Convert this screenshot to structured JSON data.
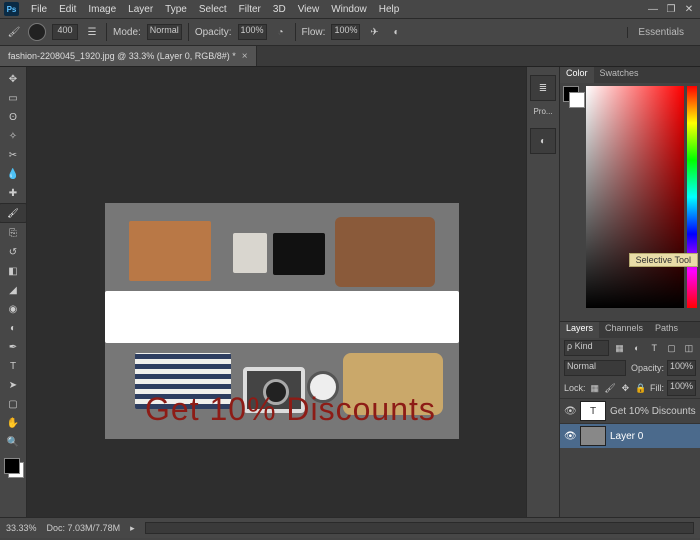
{
  "app": {
    "name": "Ps"
  },
  "menu": [
    "File",
    "Edit",
    "Image",
    "Layer",
    "Type",
    "Select",
    "Filter",
    "3D",
    "View",
    "Window",
    "Help"
  ],
  "window_buttons": {
    "min": "—",
    "restore": "❐",
    "close": "✕"
  },
  "workspace": {
    "label": "Essentials"
  },
  "options": {
    "brush_size": "400",
    "mode_label": "Mode:",
    "mode_value": "Normal",
    "opacity_label": "Opacity:",
    "opacity_value": "100%",
    "flow_label": "Flow:",
    "flow_value": "100%"
  },
  "tab": {
    "title": "fashion-2208045_1920.jpg @ 33.3% (Layer 0, RGB/8#) *"
  },
  "tools": {
    "items": [
      {
        "name": "move-tool",
        "glyph": "✥"
      },
      {
        "name": "marquee-tool",
        "glyph": "▭"
      },
      {
        "name": "lasso-tool",
        "glyph": "ʘ"
      },
      {
        "name": "magic-wand-tool",
        "glyph": "✧"
      },
      {
        "name": "crop-tool",
        "glyph": "✂"
      },
      {
        "name": "eyedropper-tool",
        "glyph": "💧"
      },
      {
        "name": "healing-brush-tool",
        "glyph": "✚"
      },
      {
        "name": "brush-tool",
        "glyph": "🖌",
        "selected": true
      },
      {
        "name": "clone-stamp-tool",
        "glyph": "⎘"
      },
      {
        "name": "history-brush-tool",
        "glyph": "↺"
      },
      {
        "name": "eraser-tool",
        "glyph": "◧"
      },
      {
        "name": "gradient-tool",
        "glyph": "◢"
      },
      {
        "name": "blur-tool",
        "glyph": "◉"
      },
      {
        "name": "dodge-tool",
        "glyph": "◐"
      },
      {
        "name": "pen-tool",
        "glyph": "✒"
      },
      {
        "name": "type-tool",
        "glyph": "T"
      },
      {
        "name": "path-select-tool",
        "glyph": "➤"
      },
      {
        "name": "shape-tool",
        "glyph": "▢"
      },
      {
        "name": "hand-tool",
        "glyph": "✋"
      },
      {
        "name": "zoom-tool",
        "glyph": "🔍"
      }
    ]
  },
  "canvas_text": "Get 10% Discounts",
  "dock": {
    "properties_label": "Pro..."
  },
  "color_panel": {
    "tabs": [
      "Color",
      "Swatches"
    ],
    "tooltip": "Selective Tool"
  },
  "layers_panel": {
    "tabs": [
      "Layers",
      "Channels",
      "Paths"
    ],
    "filter_label": "ρ Kind",
    "blend_mode": "Normal",
    "opacity_label": "Opacity:",
    "opacity_value": "100%",
    "lock_label": "Lock:",
    "fill_label": "Fill:",
    "fill_value": "100%",
    "layers": [
      {
        "name": "Get 10% Discounts",
        "type": "text"
      },
      {
        "name": "Layer 0",
        "type": "pixel",
        "active": true
      }
    ]
  },
  "status": {
    "zoom": "33.33%",
    "doc": "Doc: 7.03M/7.78M"
  }
}
